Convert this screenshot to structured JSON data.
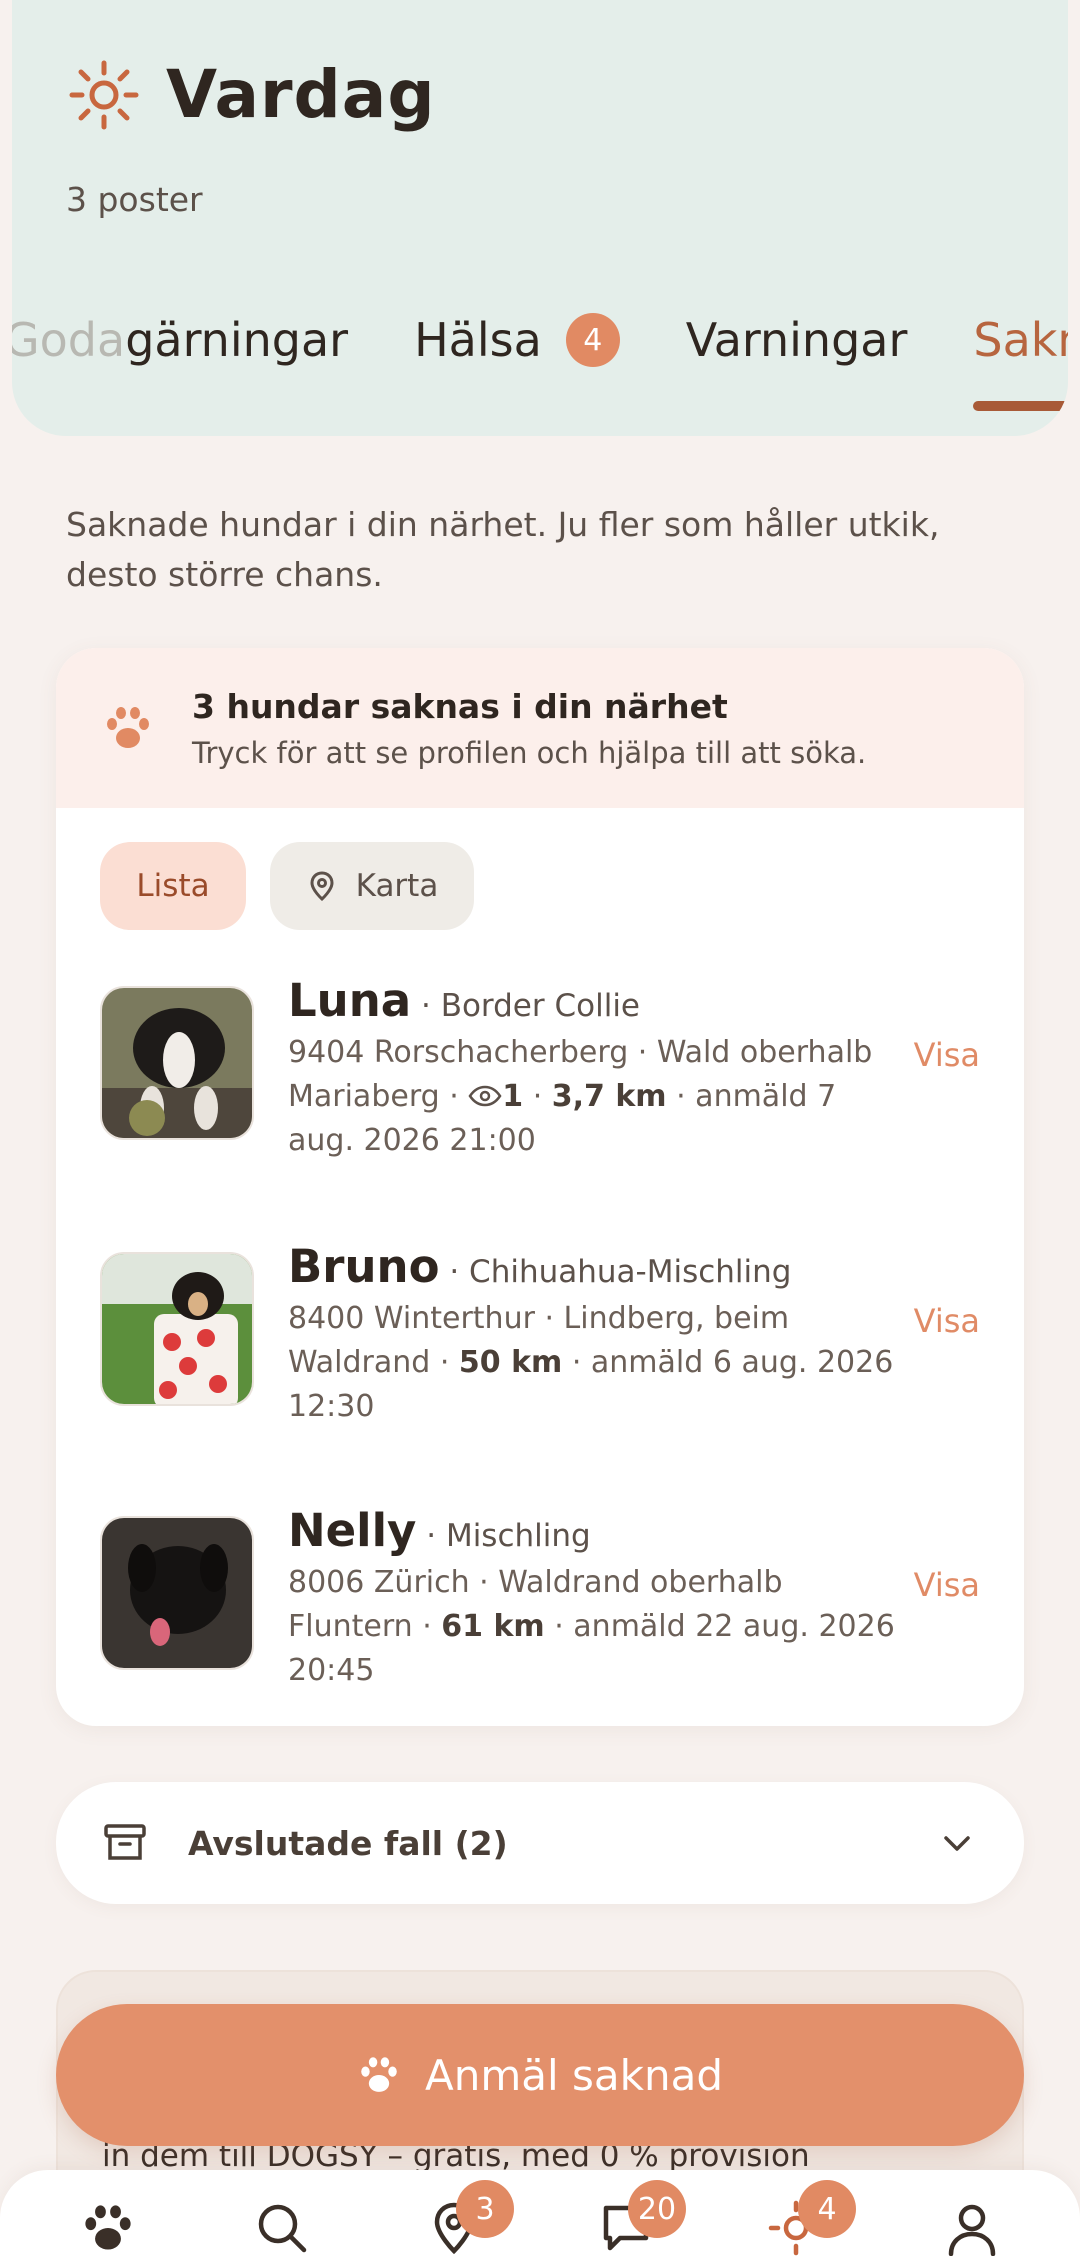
{
  "header": {
    "icon": "sun-icon",
    "title": "Vardag",
    "count_label": "3 poster",
    "tabs": [
      {
        "label_first": "Goda",
        "label_rest": " gärningar"
      },
      {
        "label": "Hälsa",
        "badge": "4"
      },
      {
        "label": "Varningar"
      },
      {
        "label": "Sakna",
        "active": true
      }
    ]
  },
  "intro": "Saknade hundar i din närhet. Ju fler som håller utkik, desto större chans.",
  "alert": {
    "icon": "paw-icon",
    "title": "3 hundar saknas i din närhet",
    "text": "Tryck för att se profilen och hjälpa till att söka."
  },
  "view_toggle": {
    "list_label": "Lista",
    "map_label": "Karta"
  },
  "dogs": [
    {
      "name": "Luna",
      "breed": "· Border Collie",
      "location": "9404 Rorschacherberg · Wald oberhalb Mariaberg · ",
      "views": "1",
      "distance": "3,7 km",
      "reported": " · anmäld 7 aug. 2026 21:00",
      "action": "Visa"
    },
    {
      "name": "Bruno",
      "breed": "· Chihuahua-Mischling",
      "location": "8400 Winterthur · Lindberg, beim Waldrand · ",
      "distance": "50 km",
      "reported": " · anmäld 6 aug. 2026 12:30",
      "action": "Visa"
    },
    {
      "name": "Nelly",
      "breed": "· Mischling",
      "location": "8006 Zürich · Waldrand oberhalb Fluntern · ",
      "distance": "61 km",
      "reported": " · anmäld 22 aug. 2026 20:45",
      "action": "Visa"
    }
  ],
  "closed_cases": {
    "label": "Avslutade fall (2)",
    "icon": "archive-icon"
  },
  "behind_text": "in dem till DOGSY – gratis, med 0 % provision",
  "cta": {
    "label": "Anmäl saknad",
    "icon": "paw-icon"
  },
  "bottom_nav": [
    {
      "icon": "paw-icon"
    },
    {
      "icon": "search-icon"
    },
    {
      "icon": "location-pin-icon",
      "badge": "3"
    },
    {
      "icon": "chat-icon",
      "badge": "20"
    },
    {
      "icon": "sun-icon",
      "badge": "4",
      "active": true
    },
    {
      "icon": "profile-icon"
    }
  ],
  "colors": {
    "accent": "#e18a63",
    "header_bg": "#e4eeea",
    "alert_bg": "#fcefeb",
    "active_tab": "#a85a37"
  }
}
